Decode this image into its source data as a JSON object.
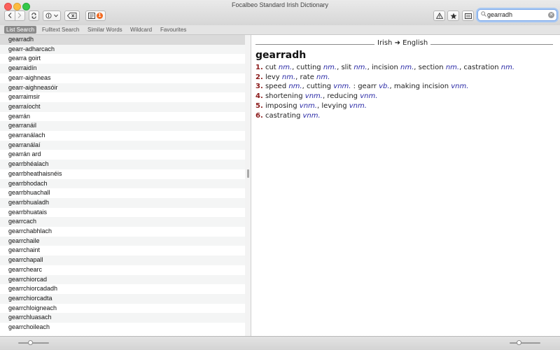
{
  "window": {
    "title": "Focalbeo Standard Irish Dictionary"
  },
  "toolbar": {
    "back_icon": "chevron-left-icon",
    "forward_icon": "chevron-right-icon",
    "sync_icon": "sync-icon",
    "info_icon": "info-icon",
    "dropdown_icon": "chevron-down-icon",
    "clear_icon": "erase-icon",
    "note_icon": "notes-icon",
    "notes_badge": "1",
    "warning_icon": "warning-icon",
    "favourite_icon": "star-icon",
    "keyboard_icon": "keyboard-icon"
  },
  "search": {
    "value": "gearradh",
    "placeholder": ""
  },
  "tabs": [
    {
      "label": "List Search",
      "active": true
    },
    {
      "label": "Fulltext Search",
      "active": false
    },
    {
      "label": "Similar Words",
      "active": false
    },
    {
      "label": "Wildcard",
      "active": false
    },
    {
      "label": "Favourites",
      "active": false
    }
  ],
  "word_list": [
    "gearradh",
    "gearr-adharcach",
    "gearra goirt",
    "gearraidín",
    "gearr-aighneas",
    "gearr-aighneasóir",
    "gearraimsir",
    "gearraíocht",
    "gearrán",
    "gearranáil",
    "gearranálach",
    "gearranálaí",
    "gearrán ard",
    "gearrbhéalach",
    "gearrbheathaisnéis",
    "gearrbhodach",
    "gearrbhuachall",
    "gearrbhualadh",
    "gearrbhuatais",
    "gearrcach",
    "gearrchabhlach",
    "gearrchaile",
    "gearrchaint",
    "gearrchapall",
    "gearrchearc",
    "gearrchiorcad",
    "gearrchiorcadadh",
    "gearrchiorcadta",
    "gearrchloigneach",
    "gearrchluasach",
    "gearrchoileach"
  ],
  "selected_index": 0,
  "entry": {
    "direction": "Irish ➜ English",
    "headword": "gearradh",
    "senses": [
      {
        "num": "1.",
        "parts": [
          [
            "t",
            "cut "
          ],
          [
            "g",
            "nm."
          ],
          [
            "t",
            ", cutting "
          ],
          [
            "g",
            "nm."
          ],
          [
            "t",
            ", slit "
          ],
          [
            "g",
            "nm."
          ],
          [
            "t",
            ", incision "
          ],
          [
            "g",
            "nm."
          ],
          [
            "t",
            ", section "
          ],
          [
            "g",
            "nm."
          ],
          [
            "t",
            ", castration "
          ],
          [
            "g",
            "nm."
          ]
        ]
      },
      {
        "num": "2.",
        "parts": [
          [
            "t",
            "levy "
          ],
          [
            "g",
            "nm."
          ],
          [
            "t",
            ", rate "
          ],
          [
            "g",
            "nm."
          ]
        ]
      },
      {
        "num": "3.",
        "parts": [
          [
            "t",
            "speed "
          ],
          [
            "g",
            "nm."
          ],
          [
            "t",
            ", cutting "
          ],
          [
            "g",
            "vnm."
          ],
          [
            "t",
            " : gearr "
          ],
          [
            "g",
            "vb."
          ],
          [
            "t",
            ", making incision "
          ],
          [
            "g",
            "vnm."
          ]
        ]
      },
      {
        "num": "4.",
        "parts": [
          [
            "t",
            "shortening "
          ],
          [
            "g",
            "vnm."
          ],
          [
            "t",
            ", reducing "
          ],
          [
            "g",
            "vnm."
          ]
        ]
      },
      {
        "num": "5.",
        "parts": [
          [
            "t",
            "imposing "
          ],
          [
            "g",
            "vnm."
          ],
          [
            "t",
            ", levying "
          ],
          [
            "g",
            "vnm."
          ]
        ]
      },
      {
        "num": "6.",
        "parts": [
          [
            "t",
            "castrating "
          ],
          [
            "g",
            "vnm."
          ]
        ]
      }
    ]
  },
  "colors": {
    "sense_number": "#8b1a1a",
    "grammar": "#2a2aa6",
    "selected_row": "#dadada",
    "active_tab": "#8a8a8a"
  },
  "bottombar": {
    "left_zoom": 0.4,
    "right_zoom": 0.3
  }
}
